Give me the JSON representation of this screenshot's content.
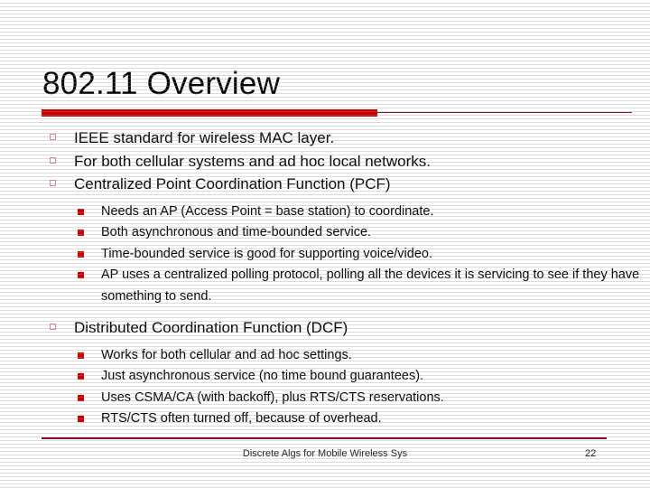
{
  "slide": {
    "title": "802.11 Overview",
    "accent_color": "#cc0000",
    "rule_color": "#8a1518",
    "footer_rule_color": "#7d1028",
    "bullets": [
      {
        "text": "IEEE standard for wireless MAC layer.",
        "children": []
      },
      {
        "text": "For both cellular systems and ad hoc local networks.",
        "children": []
      },
      {
        "text": "Centralized Point Coordination Function (PCF)",
        "children": [
          "Needs an AP (Access Point = base station) to coordinate.",
          "Both asynchronous and time-bounded service.",
          "Time-bounded service is good for supporting voice/video.",
          "AP uses a centralized polling protocol, polling all the devices it is servicing to see if they have something to send."
        ]
      },
      {
        "text": "Distributed Coordination Function (DCF)",
        "children": [
          "Works for both cellular and ad hoc settings.",
          "Just asynchronous service (no time bound guarantees).",
          "Uses CSMA/CA (with backoff), plus RTS/CTS reservations.",
          "RTS/CTS often turned off, because of overhead."
        ]
      }
    ],
    "footer": {
      "text": "Discrete Algs for Mobile Wireless Sys",
      "page_number": "22"
    }
  }
}
